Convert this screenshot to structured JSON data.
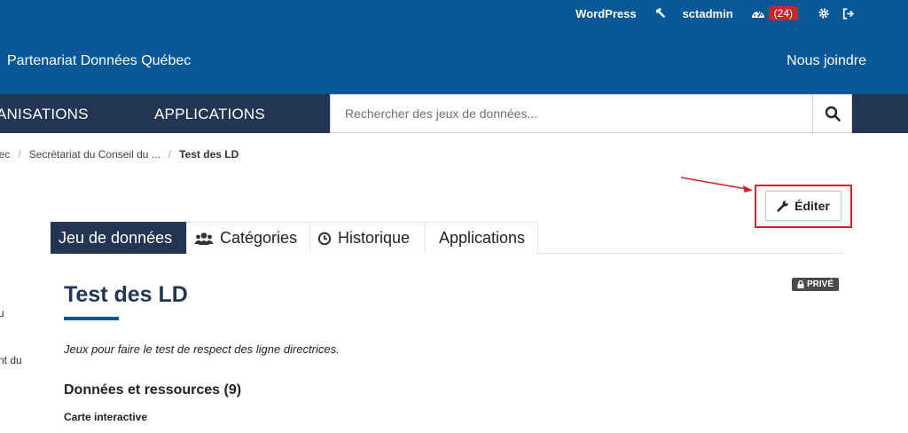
{
  "header": {
    "account": {
      "wordpress": "WordPress",
      "username": "sctadmin",
      "notifications": "(24)"
    },
    "site_title": "Partenariat Données Québec",
    "contact": "Nous joindre"
  },
  "nav": {
    "organisations": "ANISATIONS",
    "applications": "APPLICATIONS",
    "search_placeholder": "Rechercher des jeux de données..."
  },
  "breadcrumb": {
    "item1": "bec",
    "item2": "Secrétariat du Conseil du ...",
    "current": "Test des LD",
    "separator": "/"
  },
  "edit_button": {
    "label": "Éditer"
  },
  "tabs": [
    {
      "label": "Jeu de données",
      "active": true
    },
    {
      "label": "Catégories",
      "icon": "users-icon"
    },
    {
      "label": "Historique",
      "icon": "clock-icon"
    },
    {
      "label": "Applications"
    }
  ],
  "dataset": {
    "badge": "PRIVÉ",
    "title": "Test des LD",
    "description": "Jeux pour faire le test de respect des ligne directrices.",
    "resources_heading": "Données et ressources (9)",
    "first_resource": "Carte interactive"
  },
  "sidebar_fragments": [
    "u",
    "nt du"
  ],
  "colors": {
    "header_blue": "#095797",
    "nav_dark": "#223654",
    "badge_red": "#c8252c",
    "annotation_red": "#e01b22"
  }
}
